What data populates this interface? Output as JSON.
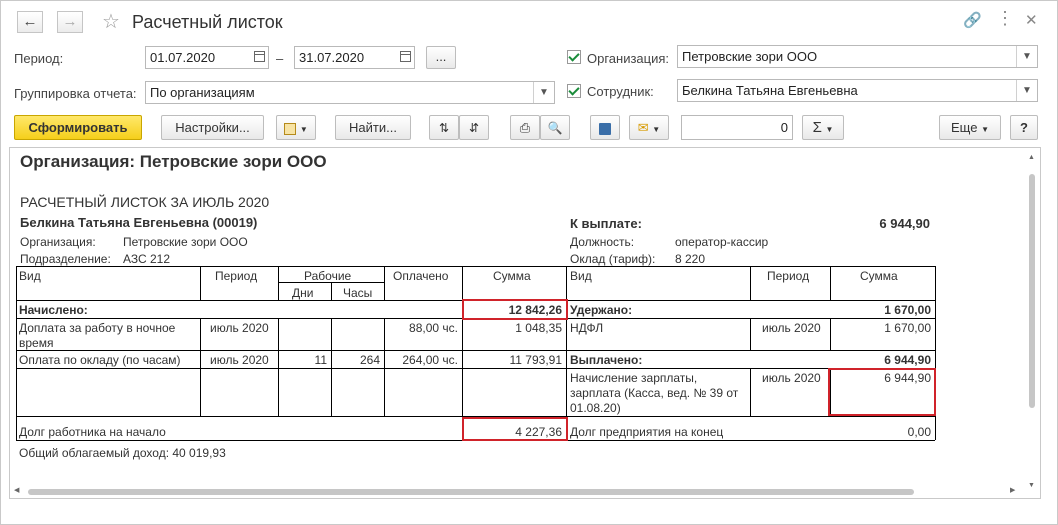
{
  "window": {
    "title": "Расчетный листок"
  },
  "filters": {
    "period_label": "Период:",
    "period_from": "01.07.2020",
    "period_dash": "–",
    "period_to": "31.07.2020",
    "more_btn": "...",
    "grouping_label": "Группировка отчета:",
    "grouping_value": "По организациям",
    "org_label": "Организация:",
    "org_value": "Петровские зори ООО",
    "emp_label": "Сотрудник:",
    "emp_value": "Белкина Татьяна Евгеньевна"
  },
  "toolbar": {
    "generate": "Сформировать",
    "settings": "Настройки...",
    "find": "Найти...",
    "number_value": "0",
    "sigma": "Σ",
    "more": "Еще",
    "help": "?"
  },
  "report": {
    "org_header": "Организация: Петровские зори ООО",
    "title": "РАСЧЕТНЫЙ ЛИСТОК ЗА ИЮЛЬ 2020",
    "employee": "Белкина Татьяна Евгеньевна (00019)",
    "org_label": "Организация:",
    "org_value": "Петровские зори ООО",
    "dept_label": "Подразделение:",
    "dept_value": "АЗС 212",
    "pay_label": "К выплате:",
    "pay_value": "6 944,90",
    "position_label": "Должность:",
    "position_value": "оператор-кассир",
    "salary_label": "Оклад (тариф):",
    "salary_value": "8 220",
    "headers": {
      "vid": "Вид",
      "period": "Период",
      "working": "Рабочие",
      "days": "Дни",
      "hours": "Часы",
      "paid": "Оплачено",
      "sum": "Сумма",
      "vid2": "Вид",
      "period2": "Период",
      "sum2": "Сумма"
    },
    "accrued_label": "Начислено:",
    "accrued_total": "12 842,26",
    "withheld_label": "Удержано:",
    "withheld_total": "1 670,00",
    "row1": {
      "vid": "Доплата за работу в ночное время",
      "period": "июль 2020",
      "paid": "88,00 чс.",
      "sum": "1 048,35"
    },
    "row1r": {
      "vid": "НДФЛ",
      "period": "июль 2020",
      "sum": "1 670,00"
    },
    "row2": {
      "vid": "Оплата по окладу (по часам)",
      "period": "июль 2020",
      "days": "11",
      "hours": "264",
      "paid": "264,00 чс.",
      "sum": "11 793,91"
    },
    "paid_out_label": "Выплачено:",
    "paid_out_total": "6 944,90",
    "row3r": {
      "vid": "Начисление зарплаты, зарплата (Касса, вед. № 39 от 01.08.20)",
      "period": "июль 2020",
      "sum": "6 944,90"
    },
    "debt_start_label": "Долг работника на начало",
    "debt_start_value": "4 227,36",
    "debt_end_label": "Долг предприятия на конец",
    "debt_end_value": "0,00",
    "total_income": "Общий облагаемый доход: 40 019,93"
  },
  "colors": {
    "accent_yellow": "#f5cf1b",
    "highlight_red": "#d0232a",
    "check_green": "#1a8c3a"
  }
}
